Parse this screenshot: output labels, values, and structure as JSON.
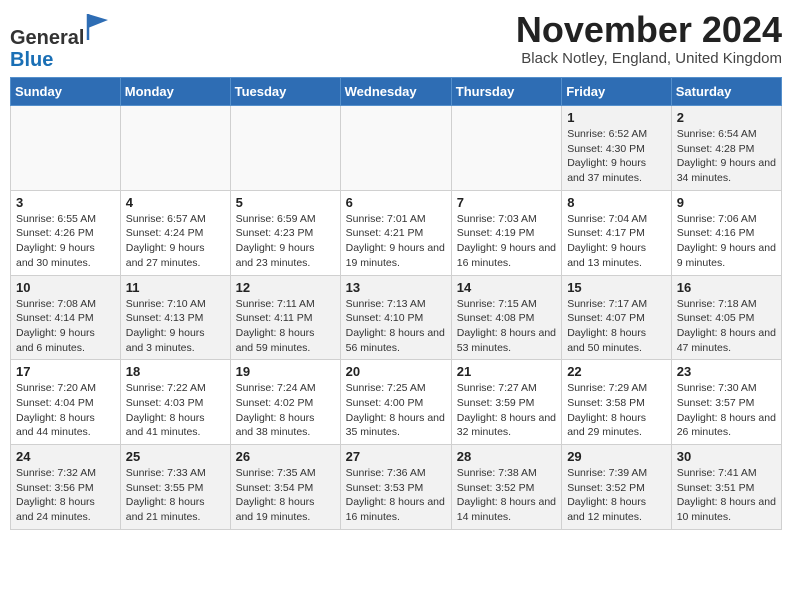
{
  "app": {
    "logo_general": "General",
    "logo_blue": "Blue",
    "month_title": "November 2024",
    "subtitle": "Black Notley, England, United Kingdom"
  },
  "calendar": {
    "headers": [
      "Sunday",
      "Monday",
      "Tuesday",
      "Wednesday",
      "Thursday",
      "Friday",
      "Saturday"
    ],
    "weeks": [
      [
        {
          "day": "",
          "info": ""
        },
        {
          "day": "",
          "info": ""
        },
        {
          "day": "",
          "info": ""
        },
        {
          "day": "",
          "info": ""
        },
        {
          "day": "",
          "info": ""
        },
        {
          "day": "1",
          "info": "Sunrise: 6:52 AM\nSunset: 4:30 PM\nDaylight: 9 hours and 37 minutes."
        },
        {
          "day": "2",
          "info": "Sunrise: 6:54 AM\nSunset: 4:28 PM\nDaylight: 9 hours and 34 minutes."
        }
      ],
      [
        {
          "day": "3",
          "info": "Sunrise: 6:55 AM\nSunset: 4:26 PM\nDaylight: 9 hours and 30 minutes."
        },
        {
          "day": "4",
          "info": "Sunrise: 6:57 AM\nSunset: 4:24 PM\nDaylight: 9 hours and 27 minutes."
        },
        {
          "day": "5",
          "info": "Sunrise: 6:59 AM\nSunset: 4:23 PM\nDaylight: 9 hours and 23 minutes."
        },
        {
          "day": "6",
          "info": "Sunrise: 7:01 AM\nSunset: 4:21 PM\nDaylight: 9 hours and 19 minutes."
        },
        {
          "day": "7",
          "info": "Sunrise: 7:03 AM\nSunset: 4:19 PM\nDaylight: 9 hours and 16 minutes."
        },
        {
          "day": "8",
          "info": "Sunrise: 7:04 AM\nSunset: 4:17 PM\nDaylight: 9 hours and 13 minutes."
        },
        {
          "day": "9",
          "info": "Sunrise: 7:06 AM\nSunset: 4:16 PM\nDaylight: 9 hours and 9 minutes."
        }
      ],
      [
        {
          "day": "10",
          "info": "Sunrise: 7:08 AM\nSunset: 4:14 PM\nDaylight: 9 hours and 6 minutes."
        },
        {
          "day": "11",
          "info": "Sunrise: 7:10 AM\nSunset: 4:13 PM\nDaylight: 9 hours and 3 minutes."
        },
        {
          "day": "12",
          "info": "Sunrise: 7:11 AM\nSunset: 4:11 PM\nDaylight: 8 hours and 59 minutes."
        },
        {
          "day": "13",
          "info": "Sunrise: 7:13 AM\nSunset: 4:10 PM\nDaylight: 8 hours and 56 minutes."
        },
        {
          "day": "14",
          "info": "Sunrise: 7:15 AM\nSunset: 4:08 PM\nDaylight: 8 hours and 53 minutes."
        },
        {
          "day": "15",
          "info": "Sunrise: 7:17 AM\nSunset: 4:07 PM\nDaylight: 8 hours and 50 minutes."
        },
        {
          "day": "16",
          "info": "Sunrise: 7:18 AM\nSunset: 4:05 PM\nDaylight: 8 hours and 47 minutes."
        }
      ],
      [
        {
          "day": "17",
          "info": "Sunrise: 7:20 AM\nSunset: 4:04 PM\nDaylight: 8 hours and 44 minutes."
        },
        {
          "day": "18",
          "info": "Sunrise: 7:22 AM\nSunset: 4:03 PM\nDaylight: 8 hours and 41 minutes."
        },
        {
          "day": "19",
          "info": "Sunrise: 7:24 AM\nSunset: 4:02 PM\nDaylight: 8 hours and 38 minutes."
        },
        {
          "day": "20",
          "info": "Sunrise: 7:25 AM\nSunset: 4:00 PM\nDaylight: 8 hours and 35 minutes."
        },
        {
          "day": "21",
          "info": "Sunrise: 7:27 AM\nSunset: 3:59 PM\nDaylight: 8 hours and 32 minutes."
        },
        {
          "day": "22",
          "info": "Sunrise: 7:29 AM\nSunset: 3:58 PM\nDaylight: 8 hours and 29 minutes."
        },
        {
          "day": "23",
          "info": "Sunrise: 7:30 AM\nSunset: 3:57 PM\nDaylight: 8 hours and 26 minutes."
        }
      ],
      [
        {
          "day": "24",
          "info": "Sunrise: 7:32 AM\nSunset: 3:56 PM\nDaylight: 8 hours and 24 minutes."
        },
        {
          "day": "25",
          "info": "Sunrise: 7:33 AM\nSunset: 3:55 PM\nDaylight: 8 hours and 21 minutes."
        },
        {
          "day": "26",
          "info": "Sunrise: 7:35 AM\nSunset: 3:54 PM\nDaylight: 8 hours and 19 minutes."
        },
        {
          "day": "27",
          "info": "Sunrise: 7:36 AM\nSunset: 3:53 PM\nDaylight: 8 hours and 16 minutes."
        },
        {
          "day": "28",
          "info": "Sunrise: 7:38 AM\nSunset: 3:52 PM\nDaylight: 8 hours and 14 minutes."
        },
        {
          "day": "29",
          "info": "Sunrise: 7:39 AM\nSunset: 3:52 PM\nDaylight: 8 hours and 12 minutes."
        },
        {
          "day": "30",
          "info": "Sunrise: 7:41 AM\nSunset: 3:51 PM\nDaylight: 8 hours and 10 minutes."
        }
      ]
    ]
  }
}
